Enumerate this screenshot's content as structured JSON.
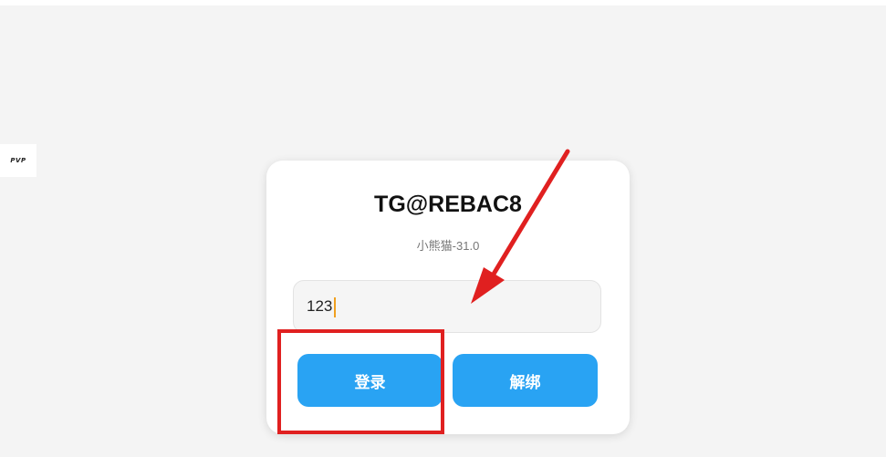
{
  "side_badge": {
    "text": "PVP"
  },
  "card": {
    "title": "TG@REBAC8",
    "subtitle": "小熊猫-31.0",
    "code_input": {
      "value": "123",
      "placeholder": ""
    },
    "login_button": {
      "label": "登录"
    },
    "unbind_button": {
      "label": "解绑"
    }
  },
  "colors": {
    "accent": "#29a3f3",
    "annotation": "#e02020",
    "background": "#f4f4f4"
  }
}
